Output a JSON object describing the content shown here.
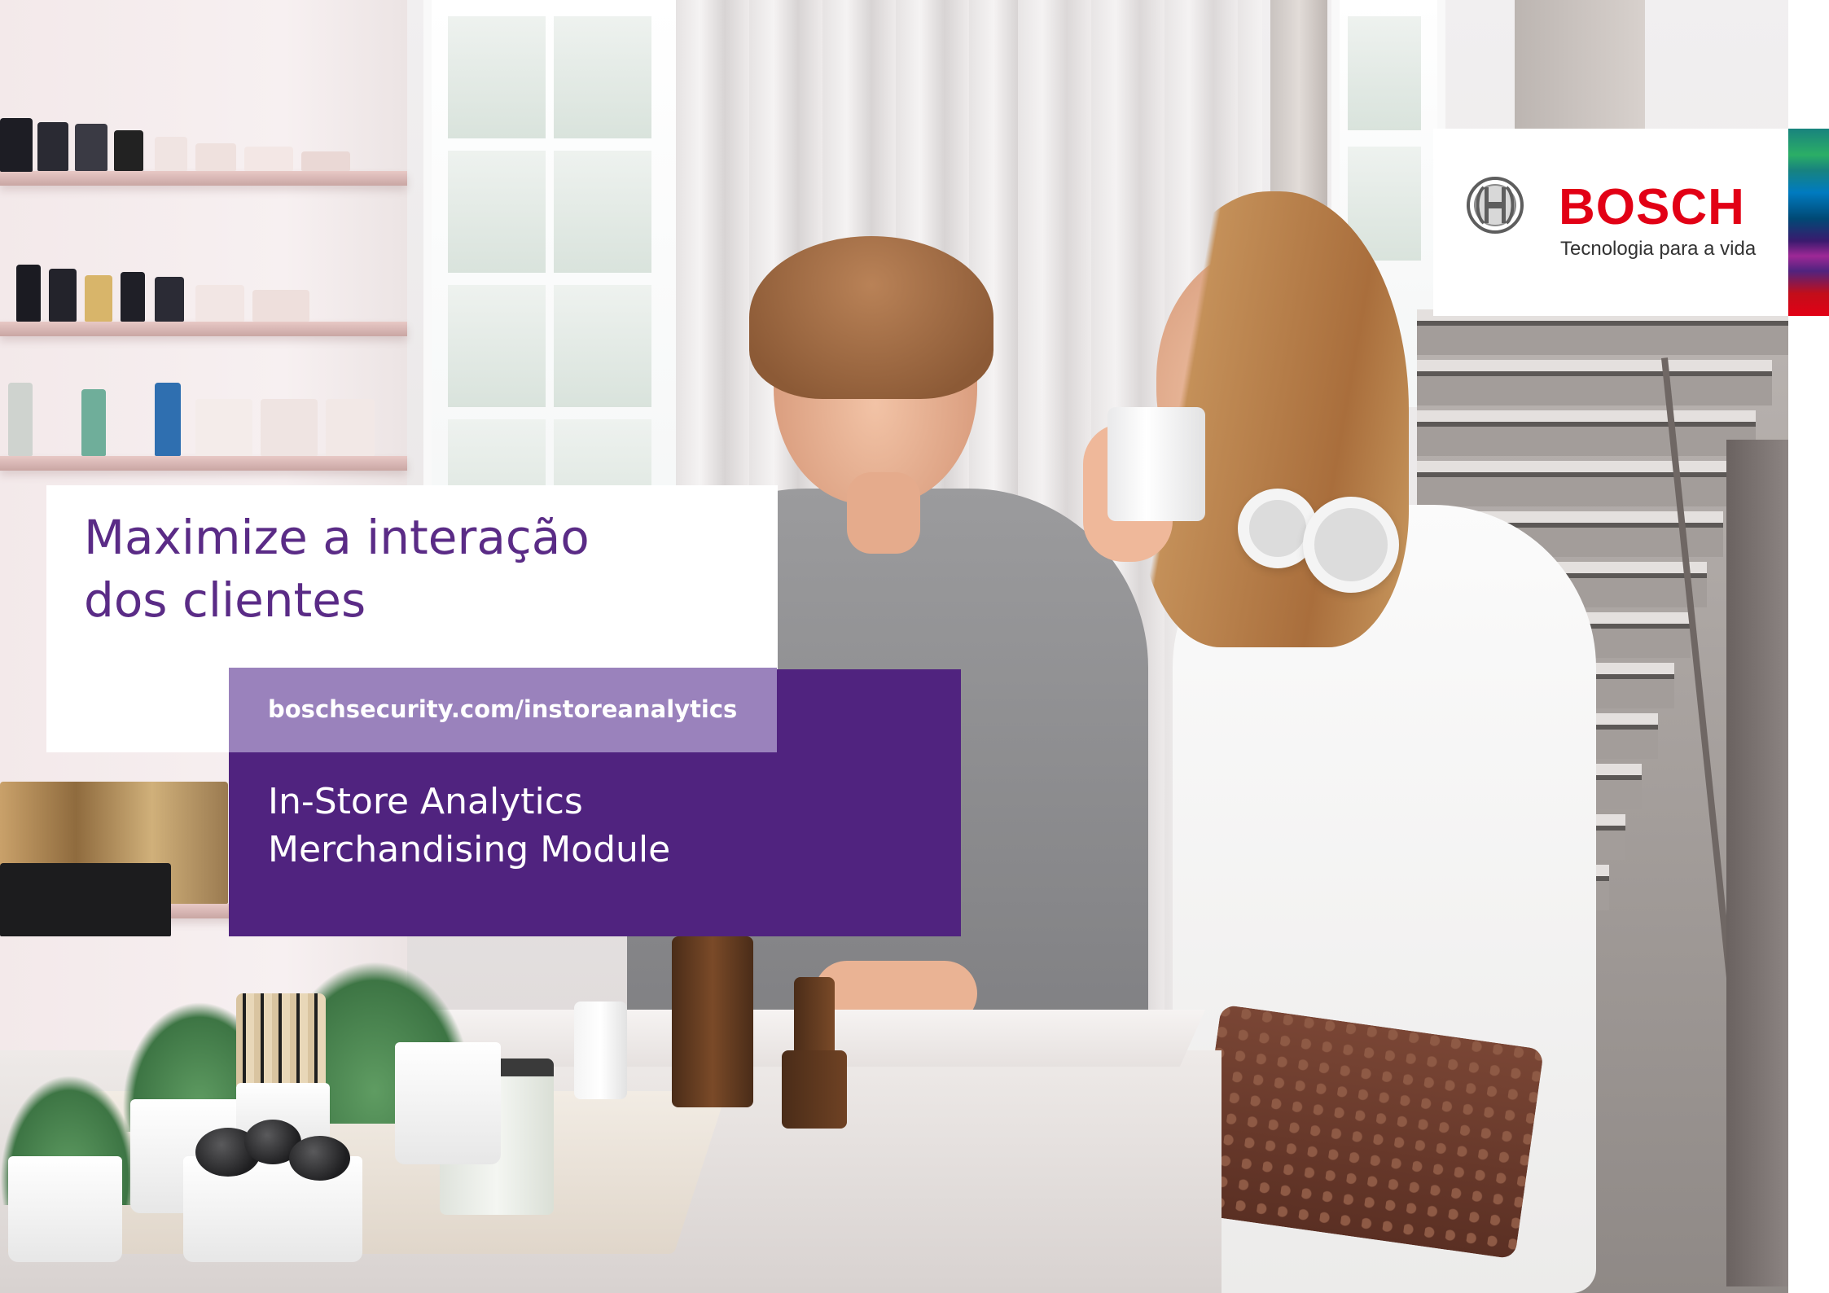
{
  "brand": {
    "name": "BOSCH",
    "tagline": "Tecnologia para a vida",
    "logo_icon": "bosch-armature-icon",
    "red": "#e20015"
  },
  "headline": {
    "line1": "Maximize a interação",
    "line2": "dos clientes",
    "color": "#5a2b86"
  },
  "url": {
    "text": "boschsecurity.com/instoreanalytics",
    "background": "#9a82bc"
  },
  "product": {
    "line1": "In-Store Analytics",
    "line2": "Merchandising Module",
    "background": "#50237f"
  },
  "photo": {
    "subject": "two-women-in-cosmetics-store"
  }
}
